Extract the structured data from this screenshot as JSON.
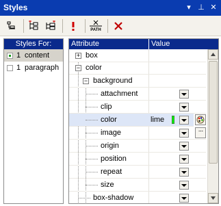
{
  "window": {
    "title": "Styles",
    "controls": [
      "dropdown-arrow-icon",
      "pin-icon",
      "close-icon"
    ]
  },
  "toolbar": {
    "buttons": [
      {
        "name": "tree-view-icon"
      },
      {
        "name": "add-rule-icon"
      },
      {
        "name": "add-child-rule-icon"
      },
      {
        "name": "important-icon",
        "label": "!"
      },
      {
        "name": "path-icon",
        "label": "PATH"
      },
      {
        "name": "delete-icon",
        "label": "✕"
      }
    ]
  },
  "styles_for": {
    "header": "Styles For:",
    "items": [
      {
        "num": "1",
        "label": "content",
        "checked": true,
        "selected": true
      },
      {
        "num": "1",
        "label": "paragraph",
        "checked": false,
        "selected": false
      }
    ]
  },
  "grid": {
    "header_attribute": "Attribute",
    "header_value": "Value",
    "rows": [
      {
        "label": "box",
        "expander": "+"
      },
      {
        "label": "color",
        "expander": "−"
      },
      {
        "label": "background",
        "expander": "−"
      },
      {
        "label": "attachment"
      },
      {
        "label": "clip"
      },
      {
        "label": "color",
        "value": "lime",
        "swatch": "#00ff00"
      },
      {
        "label": "image"
      },
      {
        "label": "origin"
      },
      {
        "label": "position"
      },
      {
        "label": "repeat"
      },
      {
        "label": "size"
      },
      {
        "label": "box-shadow"
      }
    ]
  },
  "colors": {
    "title_bar": "#0a3cb0",
    "header": "#0a2a8c",
    "highlight_row": "#dde6f7",
    "lime": "#00ff00"
  }
}
